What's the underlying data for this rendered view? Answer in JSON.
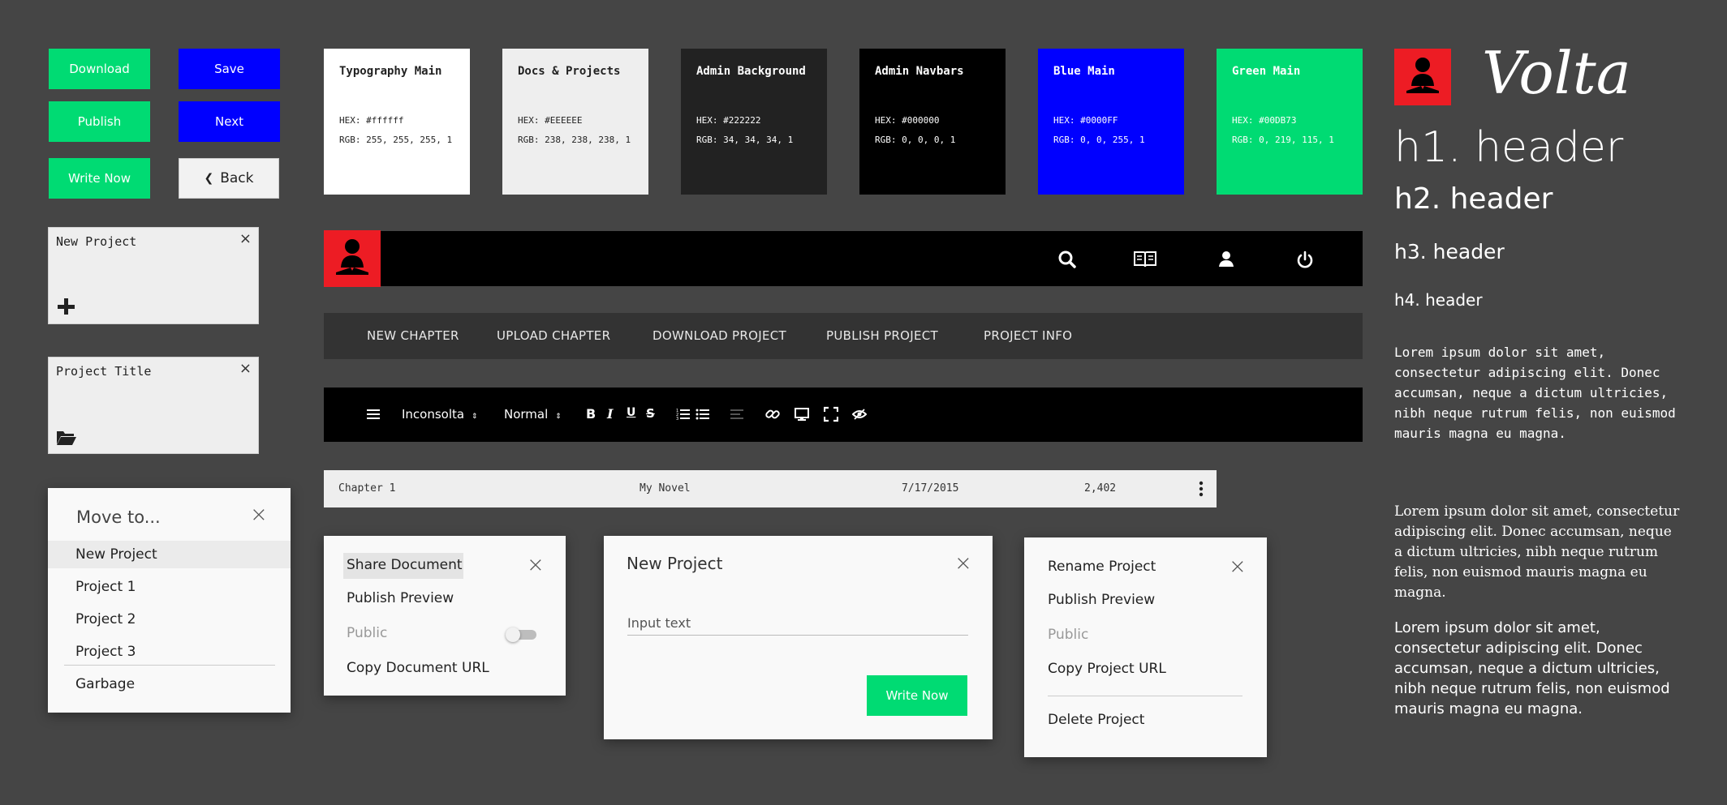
{
  "buttons": {
    "download": "Download",
    "publish": "Publish",
    "write_now": "Write Now",
    "save": "Save",
    "next": "Next",
    "back": "Back"
  },
  "cards": [
    {
      "title": "New Project",
      "icon": "plus-icon"
    },
    {
      "title": "Project Title",
      "icon": "folder-open-icon"
    }
  ],
  "swatches": [
    {
      "name": "Typography Main",
      "hex": "HEX: #ffffff",
      "rgb": "RGB: 255, 255, 255, 1",
      "bg": "#ffffff",
      "fg": "#222222"
    },
    {
      "name": "Docs & Projects",
      "hex": "HEX: #EEEEEE",
      "rgb": "RGB: 238, 238, 238, 1",
      "bg": "#EEEEEE",
      "fg": "#222222"
    },
    {
      "name": "Admin Background",
      "hex": "HEX: #222222",
      "rgb": "RGB: 34, 34, 34, 1",
      "bg": "#222222",
      "fg": "#ffffff"
    },
    {
      "name": "Admin Navbars",
      "hex": "HEX: #000000",
      "rgb": "RGB: 0, 0, 0, 1",
      "bg": "#000000",
      "fg": "#ffffff"
    },
    {
      "name": "Blue Main",
      "hex": "HEX: #0000FF",
      "rgb": "RGB: 0, 0, 255, 1",
      "bg": "#0000FF",
      "fg": "#ffffff"
    },
    {
      "name": "Green Main",
      "hex": "HEX: #00DB73",
      "rgb": "RGB: 0, 219, 115, 1",
      "bg": "#00DB73",
      "fg": "#ffffff"
    }
  ],
  "navbar": {
    "icons": [
      "search-icon",
      "book-icon",
      "user-icon",
      "power-icon"
    ]
  },
  "menubar": [
    "NEW CHAPTER",
    "UPLOAD CHAPTER",
    "DOWNLOAD PROJECT",
    "PUBLISH PROJECT",
    "PROJECT INFO"
  ],
  "toolbar": {
    "font": "Inconsolta",
    "style": "Normal"
  },
  "chapter_row": {
    "chapter": "Chapter 1",
    "project": "My Novel",
    "date": "7/17/2015",
    "words": "2,402"
  },
  "move_to": {
    "title": "Move to...",
    "items": [
      "New Project",
      "Project 1",
      "Project 2",
      "Project 3",
      "Garbage"
    ]
  },
  "share_menu": {
    "share": "Share Document",
    "publish_preview": "Publish Preview",
    "public": "Public",
    "copy_url": "Copy Document URL"
  },
  "new_project_dialog": {
    "title": "New Project",
    "input_placeholder": "Input text",
    "button": "Write Now"
  },
  "project_menu": {
    "rename": "Rename Project",
    "publish_preview": "Publish Preview",
    "public": "Public",
    "copy_url": "Copy Project URL",
    "delete": "Delete Project"
  },
  "typography": {
    "brand": "Volta",
    "h1": "h1. header",
    "h2": "h2. header",
    "h3": "h3. header",
    "h4": "h4. header",
    "p_mono": "Lorem ipsum dolor sit amet, consectetur adipiscing elit. Donec accumsan, neque a dictum ultricies, nibh neque rutrum felis, non euismod mauris magna eu magna.",
    "p_serif": "Lorem ipsum dolor sit amet, consectetur adipiscing elit. Donec accumsan, neque a dictum ultricies, nibh neque rutrum felis, non euismod mauris magna eu magna.",
    "p_sans": "Lorem ipsum dolor sit amet, consectetur adipiscing elit. Donec accumsan, neque a dictum ultricies, nibh neque rutrum felis, non euismod mauris magna eu magna."
  },
  "colors": {
    "green": "#00DB73",
    "blue": "#0000FF",
    "red": "#ED1C24",
    "background": "#454545"
  }
}
